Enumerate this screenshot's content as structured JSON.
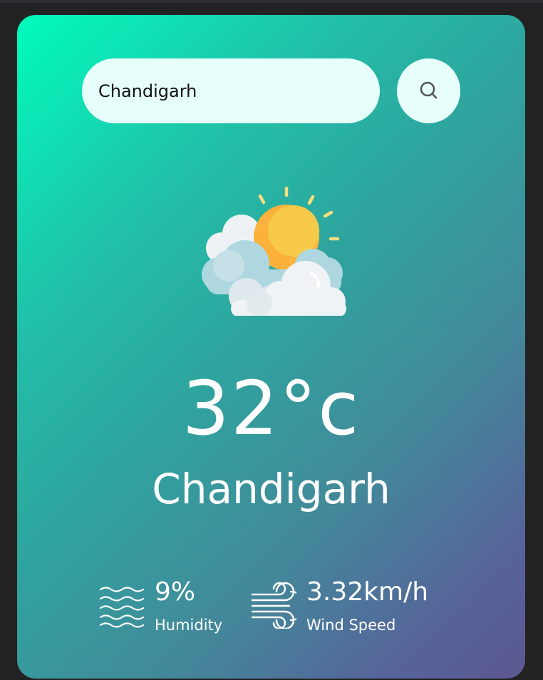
{
  "search": {
    "value": "Chandigarh",
    "placeholder": "",
    "button_icon": "search-icon"
  },
  "weather": {
    "icon": "partly-cloudy-sun-icon",
    "temperature": "32°c",
    "city": "Chandigarh"
  },
  "details": {
    "humidity": {
      "icon": "humidity-waves-icon",
      "value": "9%",
      "label": "Humidity"
    },
    "wind": {
      "icon": "wind-icon",
      "value": "3.32km/h",
      "label": "Wind Speed"
    }
  },
  "colors": {
    "gradient_start": "#00fcbd",
    "gradient_end": "#5c5791",
    "page_background": "#222222",
    "search_background": "#e6fffb",
    "text": "#ffffff"
  }
}
